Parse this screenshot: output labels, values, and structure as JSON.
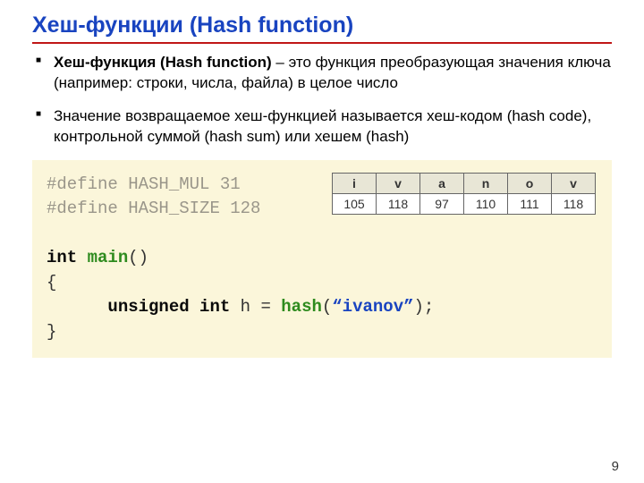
{
  "title": "Хеш-функции (Hash function)",
  "bullets": {
    "b1_strong": "Хеш-функция (Hash function)",
    "b1_rest": " – это функция преобразующая значения ключа (например: строки, числа, файла) в целое число",
    "b2": "Значение возвращаемое хеш-функцией называется хеш-кодом (hash code), контрольной суммой (hash sum) или хешем (hash)"
  },
  "code": {
    "def1_a": "#define",
    "def1_b": " HASH_MUL 31",
    "def2_a": "#define",
    "def2_b": " HASH_SIZE 128",
    "l3_int": "int",
    "l3_sp1": " ",
    "l3_main": "main",
    "l3_par": "()",
    "l4": "{",
    "l5_indent": "      ",
    "l5_unsigned": "unsigned int",
    "l5_sp": " h = ",
    "l5_hash": "hash",
    "l5_open": "(",
    "l5_str": "“ivanov”",
    "l5_close": ");",
    "l6": "}"
  },
  "table": {
    "h": [
      "i",
      "v",
      "a",
      "n",
      "o",
      "v"
    ],
    "v": [
      "105",
      "118",
      "97",
      "110",
      "111",
      "118"
    ]
  },
  "page": "9"
}
